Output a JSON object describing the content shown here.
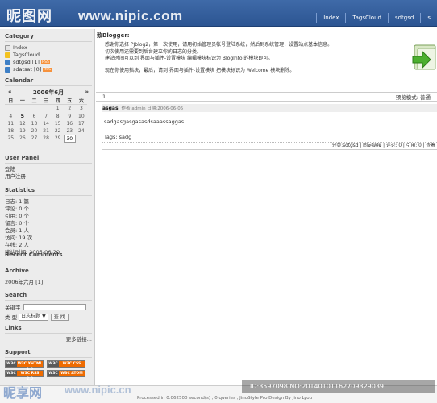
{
  "watermark": {
    "logo_text": "昵图网",
    "url_top": "www.nipic.com",
    "logo_bottom": "昵享网",
    "url_bottom": "www.nipic.cn",
    "id_text": "ID:3597098 NO:20140101162709329039"
  },
  "nav": {
    "items": [
      "Index",
      "TagsCloud",
      "sdtgsd",
      "s"
    ]
  },
  "sidebar": {
    "category": {
      "title": "Category",
      "items": [
        {
          "label": "Index",
          "icon": "page-icon",
          "color": "#d7d7d7"
        },
        {
          "label": "TagsCloud",
          "icon": "star-icon",
          "color": "#f3c21f"
        },
        {
          "label": "sdtgsd [1]",
          "icon": "folder-icon",
          "color": "#3d7fc6",
          "rss": "RSS"
        },
        {
          "label": "sdatsat [0]",
          "icon": "folder-icon",
          "color": "#3d7fc6",
          "rss": "RSS"
        }
      ]
    },
    "calendar": {
      "title": "Calendar",
      "prev": "«",
      "month": "2006年6月",
      "next": "»",
      "dow": [
        "日",
        "一",
        "二",
        "三",
        "四",
        "五",
        "六"
      ],
      "weeks": [
        [
          "",
          "",
          "",
          "",
          "1",
          "2",
          "3"
        ],
        [
          "4",
          "5",
          "6",
          "7",
          "8",
          "9",
          "10"
        ],
        [
          "11",
          "12",
          "13",
          "14",
          "15",
          "16",
          "17"
        ],
        [
          "18",
          "19",
          "20",
          "21",
          "22",
          "23",
          "24"
        ],
        [
          "25",
          "26",
          "27",
          "28",
          "29",
          "30",
          ""
        ]
      ],
      "today": "30",
      "bold_day": "5"
    },
    "user_panel": {
      "title": "User Panel",
      "items": [
        "登陆",
        "用户注册"
      ]
    },
    "statistics": {
      "title": "Statistics",
      "lines": [
        "日志: 1 篇",
        "评论: 0 个",
        "引用: 0 个",
        "留言: 0 个",
        "会员: 1 人",
        "访问: 19 次",
        "在线: 2 人",
        "建站时间: 2005-06-20"
      ]
    },
    "recent_comments": {
      "title": "Recent Comments"
    },
    "archive": {
      "title": "Archive",
      "items": [
        "2006年六月 [1]"
      ]
    },
    "search": {
      "title": "Search",
      "keyword_label": "关键字",
      "type_label": "类 型",
      "type_value": "日志标题",
      "submit": "查 找"
    },
    "links": {
      "title": "Links",
      "more": "更多链接..."
    },
    "support": {
      "title": "Support",
      "badges": [
        "W3C XHTML 1.0",
        "W3C CSS",
        "W3C RSS 2.0",
        "W3C ATOM"
      ]
    }
  },
  "main": {
    "welcome_title": "致Blogger:",
    "welcome_lines": [
      "感谢你选择 PJblog2，第一次使用，请用初始管理员帐号登陆系统，然后到系统管理，设置站点基本信息。",
      "初次使用还需要到后台建立你的日志的分类。",
      "建站时间可以到 界面与插件-设置模块 编辑模块标识为 BlogInfo 的模块即可。",
      "",
      "现在你使用指块，最后，请到 界面与插件-设置模块 把模块标识为 Welcome 模块删除。"
    ],
    "pager_left": "1",
    "pager_right": "预览模式: 普通",
    "post": {
      "title": "asgas",
      "meta": "作者:admin 日期:2006-06-05",
      "body": "sadgasgasgasasdsaaassaggas",
      "tags": "Tags: sadg",
      "footer": "分类:sdtgsd | 固定链接 | 评论: 0 | 引用: 0 | 查看"
    }
  },
  "footer": {
    "text": "Processed in 0.062500 second(s) , 0 queries , JinoStyle Pro Design By Jino Lyou"
  }
}
